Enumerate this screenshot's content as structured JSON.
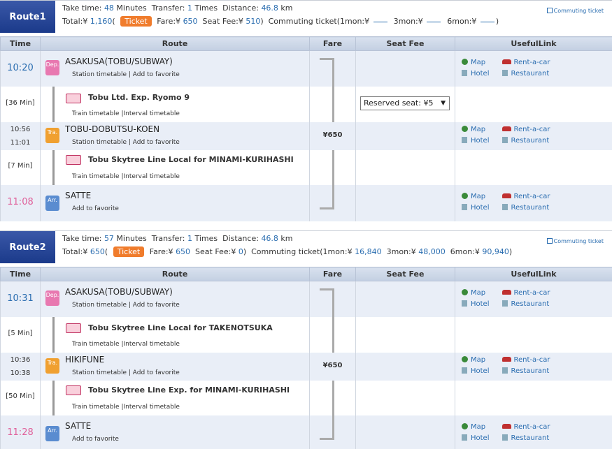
{
  "columns": {
    "time": "Time",
    "route": "Route",
    "fare": "Fare",
    "seat": "Seat Fee",
    "links": "UsefulLink"
  },
  "links": {
    "map": "Map",
    "hotel": "Hotel",
    "rent": "Rent-a-car",
    "restaurant": "Restaurant"
  },
  "station_links": {
    "timetable": "Station timetable",
    "sep": "|",
    "fav": "Add to favorite"
  },
  "train_links": {
    "timetable": "Train timetable",
    "sep": "|",
    "interval": "Interval timetable"
  },
  "commuting_link": "Commuting ticket",
  "routes": [
    {
      "label": "Route1",
      "take_time": "48",
      "transfer": "1",
      "distance": "46.8",
      "total": "1,160",
      "ticket": "Ticket",
      "fare": "650",
      "seat_fee": "510",
      "commuting": {
        "m1": "",
        "m3": "",
        "m6": ""
      },
      "dep": {
        "time": "10:20",
        "station": "ASAKUSA(TOBU/SUBWAY)",
        "icon": "Dep."
      },
      "seg1": {
        "dur": "[36 Min]",
        "train": "Tobu Ltd. Exp. Ryomo 9",
        "seat_select": "Reserved seat: ¥5"
      },
      "tra": {
        "time_arr": "10:56",
        "time_dep": "11:01",
        "station": "TOBU-DOBUTSU-KOEN",
        "icon": "Tra.",
        "fare": "¥650"
      },
      "seg2": {
        "dur": "[7 Min]",
        "train": "Tobu Skytree Line Local  for MINAMI-KURIHASHI"
      },
      "arr": {
        "time": "11:08",
        "station": "SATTE",
        "icon": "Arr."
      }
    },
    {
      "label": "Route2",
      "take_time": "57",
      "transfer": "1",
      "distance": "46.8",
      "total": "650",
      "ticket": "Ticket",
      "fare": "650",
      "seat_fee": "0",
      "commuting": {
        "m1": "16,840",
        "m3": "48,000",
        "m6": "90,940"
      },
      "dep": {
        "time": "10:31",
        "station": "ASAKUSA(TOBU/SUBWAY)",
        "icon": "Dep."
      },
      "seg1": {
        "dur": "[5 Min]",
        "train": "Tobu Skytree Line Local  for TAKENOTSUKA"
      },
      "tra": {
        "time_arr": "10:36",
        "time_dep": "10:38",
        "station": "HIKIFUNE",
        "icon": "Tra.",
        "fare": "¥650"
      },
      "seg2": {
        "dur": "[50 Min]",
        "train": "Tobu Skytree Line Exp.  for MINAMI-KURIHASHI"
      },
      "arr": {
        "time": "11:28",
        "station": "SATTE",
        "icon": "Arr."
      }
    }
  ]
}
